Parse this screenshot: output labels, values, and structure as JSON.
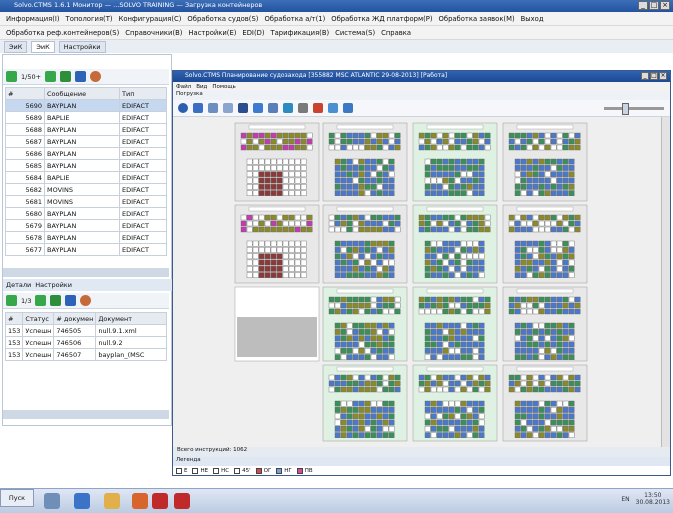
{
  "window": {
    "title": "Solvo.CTMS 1.6.1 Монитор — ...SOLVO TRAINING — Загрузка контейнеров"
  },
  "menu_main": [
    "Информация(I)",
    "Топология(T)",
    "Конфигурация(С)",
    "Обработка судов(S)",
    "Обработка а/т(1)",
    "Обработка ЖД платформ(P)",
    "Обработка заявок(M)",
    "Выход"
  ],
  "menu_second": [
    "Обработка реф.контейнеров(S)",
    "Справочники(B)",
    "Настройки(E)",
    "EDI(D)",
    "Тарификация(B)",
    "Система(S)",
    "Справка"
  ],
  "tabs": [
    "ЭиК",
    "ЭиК",
    "Настройки"
  ],
  "edi": {
    "counter": "1/50+",
    "columns": [
      "#",
      "Сообщение",
      "Тип"
    ],
    "rows": [
      {
        "id": "5690",
        "msg": "BAYPLAN",
        "type": "EDIFACT"
      },
      {
        "id": "5689",
        "msg": "BAPLIE",
        "type": "EDIFACT"
      },
      {
        "id": "5688",
        "msg": "BAYPLAN",
        "type": "EDIFACT"
      },
      {
        "id": "5687",
        "msg": "BAYPLAN",
        "type": "EDIFACT"
      },
      {
        "id": "5686",
        "msg": "BAYPLAN",
        "type": "EDIFACT"
      },
      {
        "id": "5685",
        "msg": "BAYPLAN",
        "type": "EDIFACT"
      },
      {
        "id": "5684",
        "msg": "BAPLIE",
        "type": "EDIFACT"
      },
      {
        "id": "5682",
        "msg": "MOVINS",
        "type": "EDIFACT"
      },
      {
        "id": "5681",
        "msg": "MOVINS",
        "type": "EDIFACT"
      },
      {
        "id": "5680",
        "msg": "BAYPLAN",
        "type": "EDIFACT"
      },
      {
        "id": "5679",
        "msg": "BAYPLAN",
        "type": "EDIFACT"
      },
      {
        "id": "5678",
        "msg": "BAYPLAN",
        "type": "EDIFACT"
      },
      {
        "id": "5677",
        "msg": "BAYPLAN",
        "type": "EDIFACT"
      }
    ]
  },
  "detail": {
    "tabs": [
      "Детали",
      "Настройки"
    ],
    "counter": "1/3",
    "columns": [
      "#",
      "Статус",
      "# докумен",
      "Документ"
    ],
    "rows": [
      {
        "id": "153",
        "status": "Успешн",
        "doc_no": "746505",
        "doc": "null.9.1.xml"
      },
      {
        "id": "153",
        "status": "Успешн",
        "doc_no": "746506",
        "doc": "null.9.2"
      },
      {
        "id": "153",
        "status": "Успешн",
        "doc_no": "746507",
        "doc": "bayplan_(MSC"
      }
    ]
  },
  "bay_window": {
    "title": "Solvo.CTMS Планирование судозахода [355882 MSC ATLANTIC 29-08-2013] [Работа]",
    "menu": [
      "Файл",
      "Вид",
      "Помощь"
    ],
    "sub": "Погрузка",
    "status": "Всего инструкций: 1062",
    "legend_title": "Легенда",
    "legend": [
      {
        "label": "Е",
        "color": "#ffffff"
      },
      {
        "label": "НЕ",
        "color": "#ffffff"
      },
      {
        "label": "НС",
        "color": "#ffffff"
      },
      {
        "label": "45'",
        "color": "#ffffff"
      },
      {
        "label": "ОГ",
        "color": "#d24a4a"
      },
      {
        "label": "НГ",
        "color": "#6fa3d8"
      },
      {
        "label": "ПВ",
        "color": "#d84aa0"
      }
    ]
  },
  "taskbar": {
    "start": "Пуск",
    "lang": "EN",
    "time": "13:50",
    "date": "30.08.2013"
  },
  "colors": {
    "accent": "#2452a0",
    "olive": "#8a8a2c",
    "teal": "#3a8f5a",
    "blue": "#4b78c8",
    "maroon": "#8b3a3a",
    "magenta": "#c33bb0",
    "panel_green": "#dff1e2",
    "panel_gray": "#e8e8e8"
  }
}
